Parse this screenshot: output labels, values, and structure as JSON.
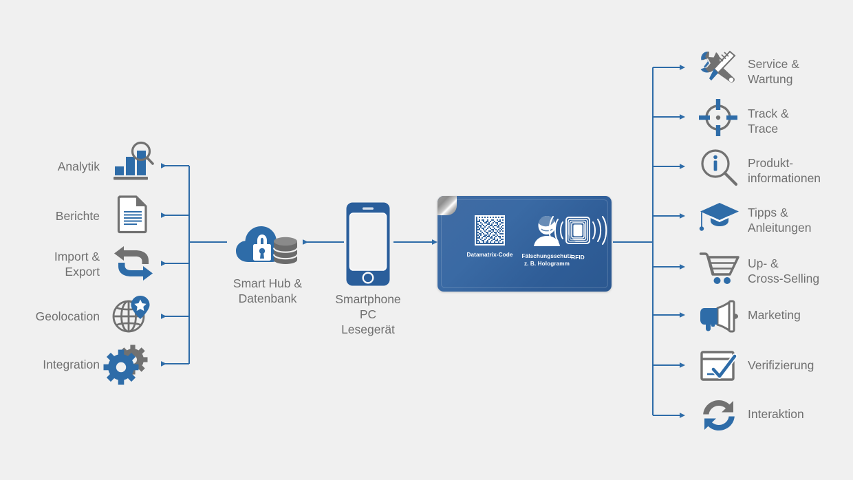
{
  "colors": {
    "background": "#f0f0f0",
    "blue": "#2e6ca8",
    "blue_dark": "#26578a",
    "gray": "#717171",
    "text_gray": "#707070",
    "card_blue": "#35669e"
  },
  "left_branch": {
    "name": "backend-outputs",
    "items": [
      {
        "label": "Analytik",
        "icon": "analytics-chart-magnifier-icon"
      },
      {
        "label": "Berichte",
        "icon": "report-document-icon"
      },
      {
        "label": "Import &\nExport",
        "icon": "import-export-arrows-icon"
      },
      {
        "label": "Geolocation",
        "icon": "globe-map-pin-icon"
      },
      {
        "label": "Integration",
        "icon": "gears-integration-icon"
      }
    ]
  },
  "hub": {
    "label": "Smart Hub &\nDatenbank",
    "icon": "cloud-lock-database-icon"
  },
  "reader": {
    "label": "Smartphone\nPC\nLesegerät",
    "icon": "smartphone-icon"
  },
  "card": {
    "name": "product-tag-card",
    "columns": [
      {
        "caption": "Datamatrix-Code",
        "icon": "datamatrix-code-icon"
      },
      {
        "caption": "Fälschungsschutz\nz. B. Hologramm",
        "icon": "hologram-person-icon"
      },
      {
        "caption": "RFID",
        "icon": "rfid-chip-icon"
      }
    ],
    "corner": "folded-corner-foil"
  },
  "right_branch": {
    "name": "application-use-cases",
    "items": [
      {
        "label": "Service &\nWartung",
        "icon": "wrench-screwdriver-icon"
      },
      {
        "label": "Track &\nTrace",
        "icon": "crosshair-target-icon"
      },
      {
        "label": "Produkt-\ninformationen",
        "icon": "info-magnifier-icon"
      },
      {
        "label": "Tipps &\nAnleitungen",
        "icon": "graduation-cap-icon"
      },
      {
        "label": "Up- &\nCross-Selling",
        "icon": "shopping-cart-icon"
      },
      {
        "label": "Marketing",
        "icon": "megaphone-icon"
      },
      {
        "label": "Verifizierung",
        "icon": "checkmark-box-icon"
      },
      {
        "label": "Interaktion",
        "icon": "refresh-cycle-icon"
      }
    ]
  }
}
